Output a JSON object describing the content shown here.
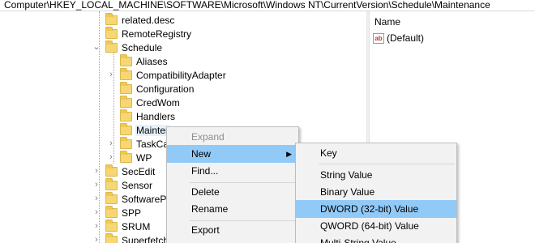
{
  "address": "Computer\\HKEY_LOCAL_MACHINE\\SOFTWARE\\Microsoft\\Windows NT\\CurrentVersion\\Schedule\\Maintenance",
  "tree": {
    "items": [
      {
        "label": "related.desc"
      },
      {
        "label": "RemoteRegistry"
      },
      {
        "label": "Schedule"
      },
      {
        "label": "Aliases"
      },
      {
        "label": "CompatibilityAdapter"
      },
      {
        "label": "Configuration"
      },
      {
        "label": "CredWom"
      },
      {
        "label": "Handlers"
      },
      {
        "label": "Mainter"
      },
      {
        "label": "TaskCac"
      },
      {
        "label": "WP"
      },
      {
        "label": "SecEdit"
      },
      {
        "label": "Sensor"
      },
      {
        "label": "SoftwarePro"
      },
      {
        "label": "SPP"
      },
      {
        "label": "SRUM"
      },
      {
        "label": "Superfetch"
      }
    ]
  },
  "values_pane": {
    "column_name": "Name",
    "rows": [
      {
        "name": "(Default)",
        "icon": "ab"
      }
    ]
  },
  "context_menu": {
    "items": [
      "Expand",
      "New",
      "Find...",
      "Delete",
      "Rename",
      "Export"
    ]
  },
  "new_submenu": {
    "items": [
      "Key",
      "String Value",
      "Binary Value",
      "DWORD (32-bit) Value",
      "QWORD (64-bit) Value",
      "Multi-String Value"
    ],
    "highlighted": "DWORD (32-bit) Value"
  },
  "colors": {
    "folder": "#f7d774",
    "menu_highlight": "#91c9f7",
    "selection": "#e5f1fb"
  }
}
